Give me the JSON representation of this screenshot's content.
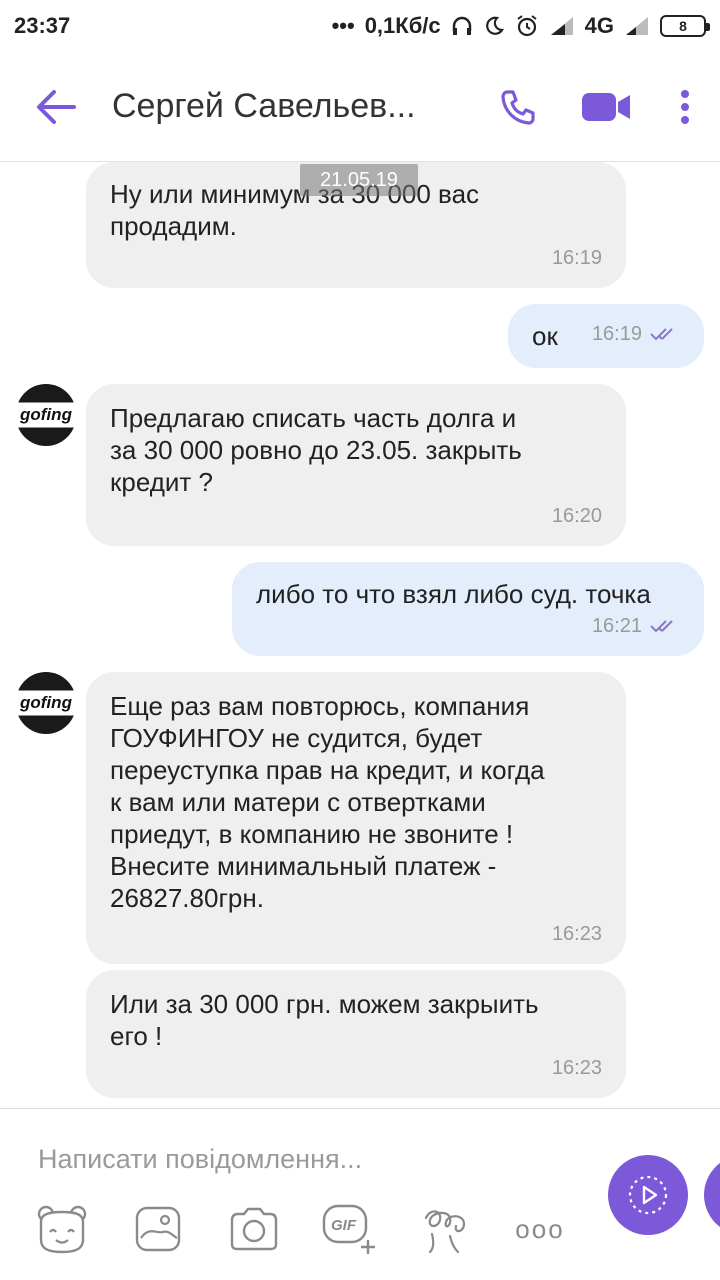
{
  "status_bar": {
    "time": "23:37",
    "dots": "•••",
    "net_speed": "0,1Кб/с",
    "network": "4G",
    "battery": "8"
  },
  "toolbar": {
    "title": "Сергей Савельев...",
    "back_icon": "arrow-left-icon",
    "call_icon": "phone-icon",
    "video_icon": "video-camera-icon",
    "more_icon": "more-vertical-icon",
    "accent": "#7c59d8"
  },
  "chat": {
    "date_label": "21.05.19",
    "avatar_text": "goﬁng",
    "messages": [
      {
        "direction": "in",
        "text": "Ну или минимум за 30 000 вас\nпродадим.",
        "time": "16:19"
      },
      {
        "direction": "out",
        "text": "ок",
        "time": "16:19"
      },
      {
        "direction": "in",
        "text": "Предлагаю списать часть долга и\nза 30 000 ровно до 23.05. закрыть\nкредит  ?",
        "time": "16:20"
      },
      {
        "direction": "out",
        "text": "либо то что взял либо суд. точка",
        "time": "16:21"
      },
      {
        "direction": "in",
        "text": "Еще раз вам повторюсь, компания\nГОУФИНГОУ не судится, будет\nпереуступка прав на кредит, и когда\nк вам или матери  с отвертками\nприедут, в компанию не звоните !\nВнесите минимальный платеж -\n26827.80грн.",
        "time": "16:23"
      },
      {
        "direction": "in",
        "text": "Или за 30 000 грн. можем закрыить\nего !",
        "time": "16:23"
      }
    ]
  },
  "composer": {
    "placeholder": "Написати повідомлення...",
    "gif_label": "GIF",
    "more_label": "ooo",
    "tools": [
      "sticker-icon",
      "gallery-icon",
      "camera-icon",
      "gif-icon",
      "doodle-icon",
      "more-horizontal-icon"
    ]
  }
}
